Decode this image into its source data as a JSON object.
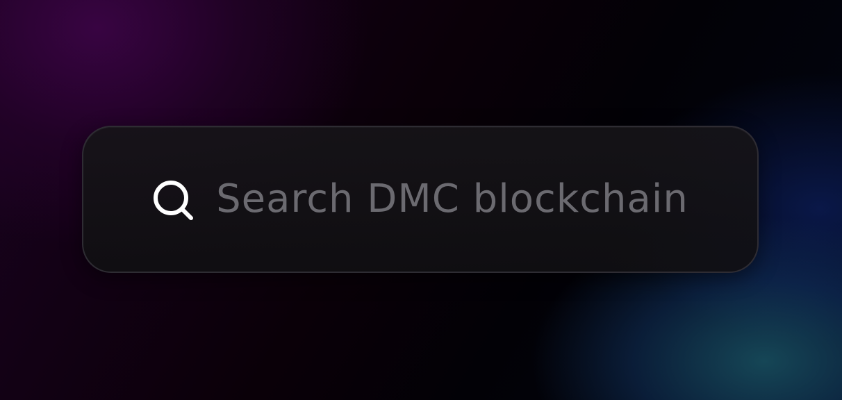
{
  "search": {
    "placeholder": "Search DMC blockchain",
    "icon": "search-icon"
  },
  "colors": {
    "placeholder_text": "#6b6a70",
    "icon": "#ffffff",
    "box_border": "#2e2c33",
    "box_background": "#131216"
  }
}
